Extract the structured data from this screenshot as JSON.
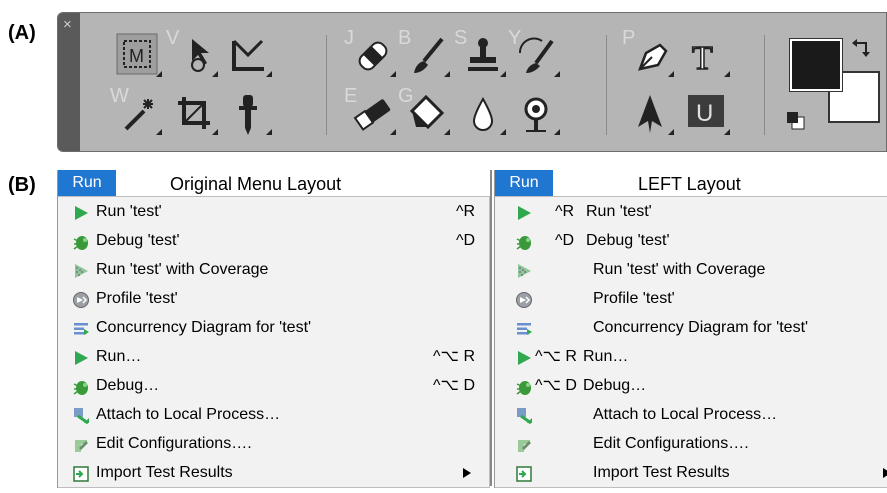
{
  "panel_a_label": "(A)",
  "panel_b_label": "(B)",
  "toolbar": {
    "close_glyph": "×",
    "tools": [
      {
        "name": "marquee-tool",
        "letter": "M"
      },
      {
        "name": "move-tool",
        "letter": "V"
      },
      {
        "name": "crop-slice-tool",
        "letter": ""
      },
      {
        "name": "magic-wand-tool",
        "letter": "W"
      },
      {
        "name": "crop-tool",
        "letter": ""
      },
      {
        "name": "eyedropper-tool",
        "letter": ""
      },
      {
        "name": "healing-brush-tool",
        "letter": "J"
      },
      {
        "name": "brush-tool",
        "letter": "B"
      },
      {
        "name": "clone-stamp-tool",
        "letter": "S"
      },
      {
        "name": "history-brush-tool",
        "letter": "Y"
      },
      {
        "name": "eraser-tool",
        "letter": "E"
      },
      {
        "name": "paint-bucket-tool",
        "letter": "G"
      },
      {
        "name": "blur-tool",
        "letter": ""
      },
      {
        "name": "dodge-tool",
        "letter": ""
      },
      {
        "name": "pen-tool",
        "letter": "P"
      },
      {
        "name": "type-tool",
        "letter": "T"
      },
      {
        "name": "path-selection-tool",
        "letter": ""
      },
      {
        "name": "shape-tool",
        "letter": "U"
      }
    ],
    "foreground_color": "#1a1a1a",
    "background_color": "#ffffff"
  },
  "menus": {
    "run_tab": "Run",
    "original": {
      "title": "Original Menu Layout",
      "items": [
        {
          "label": "Run 'test'",
          "shortcut": "^R",
          "icon": "run-icon"
        },
        {
          "label": "Debug 'test'",
          "shortcut": "^D",
          "icon": "debug-icon"
        },
        {
          "label": "Run 'test'  with Coverage",
          "shortcut": "",
          "icon": "coverage-icon"
        },
        {
          "label": "Profile 'test'",
          "shortcut": "",
          "icon": "profile-icon"
        },
        {
          "label": "Concurrency  Diagram for 'test'",
          "shortcut": "",
          "icon": "concurrency-icon"
        },
        {
          "label": "Run…",
          "shortcut": "^⌥ R",
          "icon": "run-icon"
        },
        {
          "label": "Debug…",
          "shortcut": "^⌥ D",
          "icon": "debug-icon"
        },
        {
          "label": "Attach  to Local Process…",
          "shortcut": "",
          "icon": "attach-icon"
        },
        {
          "label": "Edit  Configurations….",
          "shortcut": "",
          "icon": "edit-config-icon"
        },
        {
          "label": "Import Test Results",
          "shortcut": "",
          "icon": "import-icon",
          "submenu": true
        }
      ]
    },
    "left": {
      "title": "LEFT Layout",
      "items": [
        {
          "label": "Run 'test'",
          "shortcut": "^R",
          "icon": "run-icon"
        },
        {
          "label": "Debug 'test'",
          "shortcut": "^D",
          "icon": "debug-icon"
        },
        {
          "label": "Run 'test'  with Coverage",
          "shortcut": "",
          "icon": "coverage-icon"
        },
        {
          "label": "Profile 'test'",
          "shortcut": "",
          "icon": "profile-icon"
        },
        {
          "label": "Concurrency  Diagram for 'test'",
          "shortcut": "",
          "icon": "concurrency-icon"
        },
        {
          "label": "Run…",
          "shortcut": "^⌥ R",
          "icon": "run-icon"
        },
        {
          "label": "Debug…",
          "shortcut": "^⌥ D",
          "icon": "debug-icon"
        },
        {
          "label": "Attach  to Local Process…",
          "shortcut": "",
          "icon": "attach-icon"
        },
        {
          "label": "Edit  Configurations….",
          "shortcut": "",
          "icon": "edit-config-icon"
        },
        {
          "label": "Import Test Results",
          "shortcut": "",
          "icon": "import-icon",
          "submenu": true
        }
      ]
    }
  }
}
